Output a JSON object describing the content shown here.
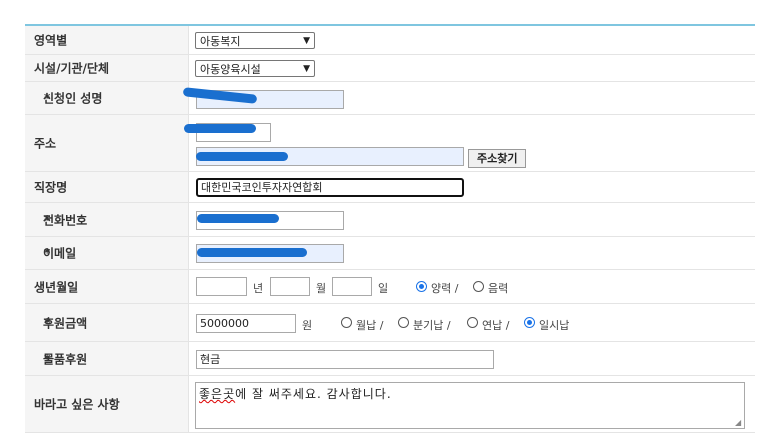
{
  "fields": {
    "category": {
      "label": "영역별",
      "value": "아동복지"
    },
    "facility": {
      "label": "시설/기관/단체",
      "value": "아동양육시설"
    },
    "name": {
      "label": "신청인 성명",
      "required": "*"
    },
    "address": {
      "label": "주소",
      "search_label": "주소찾기"
    },
    "workplace": {
      "label": "직장명",
      "value": "대한민국코인투자자연합회"
    },
    "phone": {
      "label": "전화번호",
      "required": "*"
    },
    "email": {
      "label": "이메일",
      "required": "*"
    },
    "birth": {
      "label": "생년월일",
      "year": "년",
      "month": "월",
      "day": "일",
      "solar": "양력 /",
      "lunar": "음력",
      "selected": "solar"
    },
    "amount": {
      "label": "후원금액",
      "required": "*",
      "value": "5000000",
      "unit": "원",
      "monthly": "월납 /",
      "quarterly": "분기납 /",
      "yearly": "연납 /",
      "once": "일시납",
      "selected": "once"
    },
    "goods": {
      "label": "물품후원",
      "required": "*",
      "value": "현금"
    },
    "wish": {
      "label": "바라고 싶은 사항",
      "value_misspelled": "좋은곳",
      "value_rest": "에 잘 써주세요. 감사합니다."
    }
  },
  "colors": {
    "accent_line": "#7fc6e0",
    "required": "#d0021b",
    "radio": "#1a73e8",
    "redaction": "#1a6fcf"
  }
}
